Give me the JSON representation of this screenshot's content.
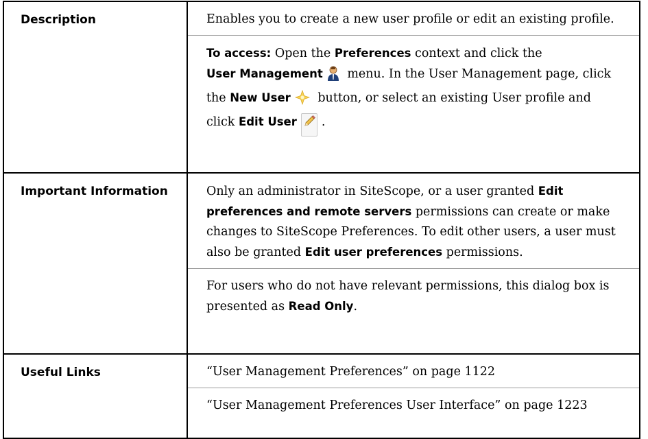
{
  "rows": [
    {
      "label": "Description",
      "paragraphs": [
        {
          "text": "Enables you to create a new user profile or edit an existing profile."
        },
        {
          "access_prefix": "To access:",
          "t1": " Open the ",
          "preferences": "Preferences",
          "t2": " context and click the ",
          "user_management": "User Management",
          "t3": " menu. In the User Management page, click the ",
          "new_user": "New User",
          "t4": " button, or select an existing User profile and click ",
          "edit_user": "Edit User",
          "t5": "."
        }
      ]
    },
    {
      "label": "Important Information",
      "paragraphs": [
        {
          "t1": "Only an administrator in SiteScope, or a user granted ",
          "b1": "Edit preferences and remote servers",
          "t2": " permissions can create or make changes to SiteScope Preferences. To edit other users, a user must also be granted ",
          "b2": "Edit user preferences",
          "t3": " permissions."
        },
        {
          "t1": "For users who do not have relevant permissions, this dialog box is presented as ",
          "b1": "Read Only",
          "t2": "."
        }
      ]
    },
    {
      "label": "Useful Links",
      "links": [
        "“User Management Preferences” on page 1122",
        "“User Management Preferences User Interface” on page 1223"
      ]
    }
  ],
  "icons": {
    "user_management": "user-management-icon",
    "new_user": "new-user-icon",
    "edit_user": "edit-user-pencil-icon"
  }
}
